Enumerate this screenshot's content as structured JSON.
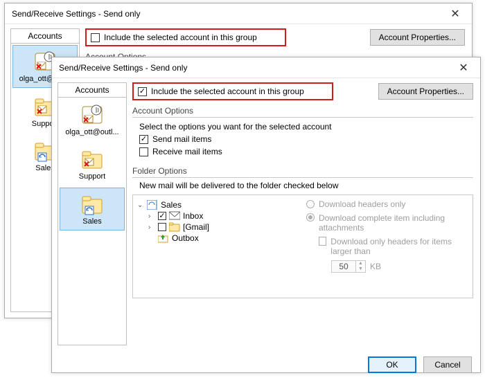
{
  "back": {
    "title": "Send/Receive Settings - Send only",
    "sidebar_header": "Accounts",
    "accounts": [
      {
        "label": "olga_ott@out..."
      },
      {
        "label": "Support"
      },
      {
        "label": "Sales"
      }
    ],
    "include_label": "Include the selected account in this group",
    "account_props": "Account Properties...",
    "account_options_head": "Account Options"
  },
  "front": {
    "title": "Send/Receive Settings - Send only",
    "sidebar_header": "Accounts",
    "accounts": [
      {
        "label": "olga_ott@outl..."
      },
      {
        "label": "Support"
      },
      {
        "label": "Sales"
      }
    ],
    "include_label": "Include the selected account in this group",
    "account_props": "Account Properties...",
    "account_options_head": "Account Options",
    "select_options_text": "Select the options you want for the selected account",
    "send_mail": "Send mail items",
    "receive_mail": "Receive mail items",
    "folder_options_head": "Folder Options",
    "folder_sub": "New mail will be delivered to the folder checked below",
    "tree": {
      "root": "Sales",
      "inbox": "Inbox",
      "gmail": "[Gmail]",
      "outbox": "Outbox"
    },
    "dl_headers": "Download headers only",
    "dl_complete": "Download complete item including attachments",
    "dl_larger": "Download only headers for items larger than",
    "kb_value": "50",
    "kb_label": "KB",
    "ok": "OK",
    "cancel": "Cancel"
  }
}
